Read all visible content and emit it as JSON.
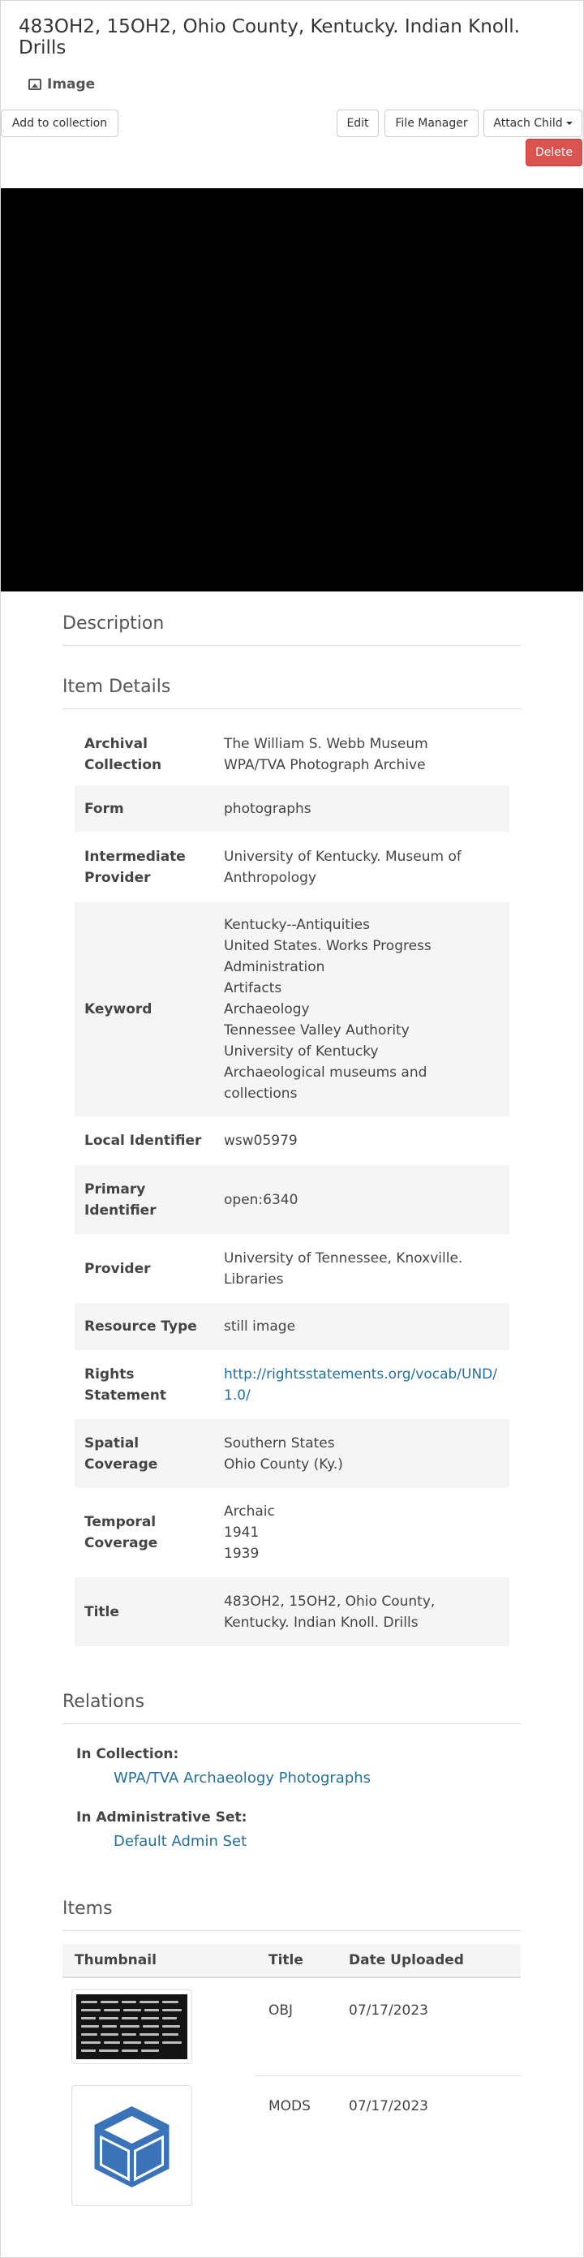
{
  "page": {
    "title": "483OH2, 15OH2, Ohio County, Kentucky. Indian Knoll. Drills",
    "type_label": "Image",
    "type_icon": "image-icon"
  },
  "toolbar": {
    "add_to_collection": "Add to collection",
    "edit": "Edit",
    "file_manager": "File Manager",
    "attach_child": "Attach Child",
    "delete": "Delete"
  },
  "sections": {
    "description": "Description",
    "item_details": "Item Details",
    "relations": "Relations",
    "items": "Items"
  },
  "details": [
    {
      "label": "Archival Collection",
      "values": [
        "The William S. Webb Museum",
        "WPA/TVA Photograph Archive"
      ]
    },
    {
      "label": "Form",
      "values": [
        "photographs"
      ]
    },
    {
      "label": "Intermediate Provider",
      "values": [
        "University of Kentucky. Museum of Anthropology"
      ]
    },
    {
      "label": "Keyword",
      "values": [
        "Kentucky--Antiquities",
        "United States. Works Progress Administration",
        "Artifacts",
        "Archaeology",
        "Tennessee Valley Authority",
        "University of Kentucky",
        "Archaeological museums and collections"
      ]
    },
    {
      "label": "Local Identifier",
      "values": [
        "wsw05979"
      ]
    },
    {
      "label": "Primary Identifier",
      "values": [
        "open:6340"
      ]
    },
    {
      "label": "Provider",
      "values": [
        "University of Tennessee, Knoxville. Libraries"
      ]
    },
    {
      "label": "Resource Type",
      "values": [
        "still image"
      ]
    },
    {
      "label": "Rights Statement",
      "values": [
        "http://rightsstatements.org/vocab/UND/1.0/"
      ]
    },
    {
      "label": "Spatial Coverage",
      "values": [
        "Southern States",
        "Ohio County (Ky.)"
      ]
    },
    {
      "label": "Temporal Coverage",
      "values": [
        "Archaic",
        "1941",
        "1939"
      ]
    },
    {
      "label": "Title",
      "values": [
        "483OH2, 15OH2, Ohio County, Kentucky. Indian Knoll. Drills"
      ]
    }
  ],
  "relations": {
    "in_collection_label": "In Collection:",
    "in_collection_value": "WPA/TVA Archaeology Photographs",
    "admin_set_label": "In Administrative Set:",
    "admin_set_value": "Default Admin Set"
  },
  "items_table": {
    "headers": [
      "Thumbnail",
      "Title",
      "Date Uploaded"
    ],
    "rows": [
      {
        "thumbnail": "photo-thumbnail",
        "title": "OBJ",
        "date": "07/17/2023"
      },
      {
        "thumbnail": "cube-icon",
        "title": "MODS",
        "date": "07/17/2023"
      }
    ]
  },
  "colors": {
    "link": "#23709e",
    "danger": "#d9534f",
    "cube": "#3a73b8"
  }
}
